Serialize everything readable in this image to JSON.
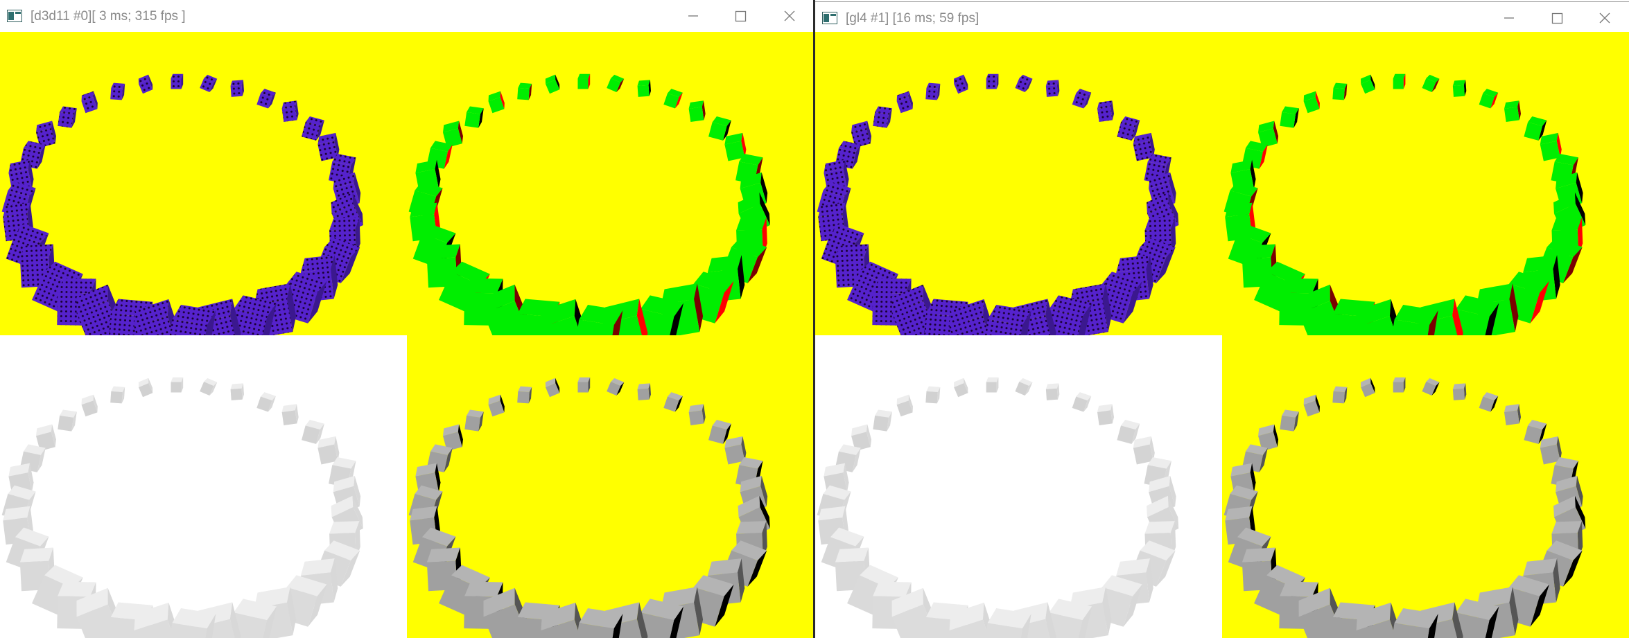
{
  "windows": [
    {
      "title": "[d3d11 #0][ 3 ms; 315 fps ]",
      "app_icon": "terminal-app-icon",
      "controls": [
        "minimize-icon",
        "maximize-icon",
        "close-icon"
      ]
    },
    {
      "title": "[gl4 #1] [16 ms; 59 fps]",
      "app_icon": "terminal-app-icon",
      "controls": [
        "minimize-icon",
        "maximize-icon",
        "close-icon"
      ]
    }
  ],
  "viewports": [
    {
      "id": "tl",
      "background": "#ffff00",
      "ring": "purple-textured"
    },
    {
      "id": "tr",
      "background": "#ffff00",
      "ring": "green-red-shaded"
    },
    {
      "id": "bl",
      "background": "#ffffff",
      "ring": "light-gray-faint"
    },
    {
      "id": "br",
      "background": "#ffff00",
      "ring": "gray-shaded"
    }
  ],
  "colors": {
    "yellow": "#ffff00",
    "purple": "#5522cc",
    "green": "#00ee00",
    "red": "#ff0000",
    "gray": "#a0a0a0",
    "lightgray": "#e8e8e8",
    "black": "#000000"
  }
}
